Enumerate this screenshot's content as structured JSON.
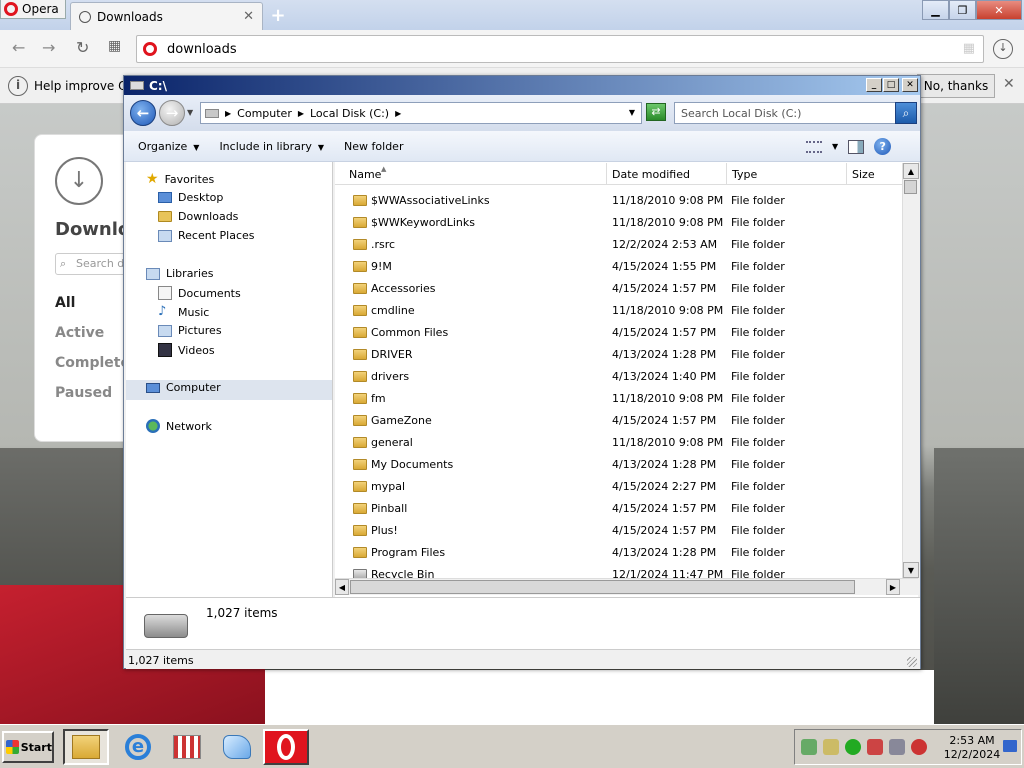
{
  "browser": {
    "menu_label": "Opera",
    "tab_title": "Downloads",
    "address": "downloads",
    "infobar_text": "Help improve Op",
    "no_thanks_label": "No, thanks",
    "downloads_page": {
      "title": "Downlo",
      "search_placeholder": "Search do",
      "filters": [
        "All",
        "Active",
        "Complete",
        "Paused"
      ]
    }
  },
  "explorer": {
    "title": "C:\\",
    "breadcrumb": [
      "Computer",
      "Local Disk (C:)"
    ],
    "search_placeholder": "Search Local Disk (C:)",
    "commands": [
      "Organize",
      "Include in library",
      "New folder"
    ],
    "nav": {
      "favorites": "Favorites",
      "favorites_items": [
        "Desktop",
        "Downloads",
        "Recent Places"
      ],
      "libraries": "Libraries",
      "libraries_items": [
        "Documents",
        "Music",
        "Pictures",
        "Videos"
      ],
      "computer": "Computer",
      "network": "Network"
    },
    "columns": [
      "Name",
      "Date modified",
      "Type",
      "Size"
    ],
    "files": [
      {
        "name": "$WWAssociativeLinks",
        "date": "11/18/2010 9:08 PM",
        "type": "File folder"
      },
      {
        "name": "$WWKeywordLinks",
        "date": "11/18/2010 9:08 PM",
        "type": "File folder"
      },
      {
        "name": ".rsrc",
        "date": "12/2/2024 2:53 AM",
        "type": "File folder"
      },
      {
        "name": "9!M",
        "date": "4/15/2024 1:55 PM",
        "type": "File folder"
      },
      {
        "name": "Accessories",
        "date": "4/15/2024 1:57 PM",
        "type": "File folder"
      },
      {
        "name": "cmdline",
        "date": "11/18/2010 9:08 PM",
        "type": "File folder"
      },
      {
        "name": "Common Files",
        "date": "4/15/2024 1:57 PM",
        "type": "File folder"
      },
      {
        "name": "DRIVER",
        "date": "4/13/2024 1:28 PM",
        "type": "File folder"
      },
      {
        "name": "drivers",
        "date": "4/13/2024 1:40 PM",
        "type": "File folder"
      },
      {
        "name": "fm",
        "date": "11/18/2010 9:08 PM",
        "type": "File folder"
      },
      {
        "name": "GameZone",
        "date": "4/15/2024 1:57 PM",
        "type": "File folder"
      },
      {
        "name": "general",
        "date": "11/18/2010 9:08 PM",
        "type": "File folder"
      },
      {
        "name": "My Documents",
        "date": "4/13/2024 1:28 PM",
        "type": "File folder"
      },
      {
        "name": "mypal",
        "date": "4/15/2024 2:27 PM",
        "type": "File folder"
      },
      {
        "name": "Pinball",
        "date": "4/15/2024 1:57 PM",
        "type": "File folder"
      },
      {
        "name": "Plus!",
        "date": "4/15/2024 1:57 PM",
        "type": "File folder"
      },
      {
        "name": "Program Files",
        "date": "4/13/2024 1:28 PM",
        "type": "File folder"
      },
      {
        "name": "Recycle Bin",
        "date": "12/1/2024 11:47 PM",
        "type": "File folder"
      }
    ],
    "details_count": "1,027 items",
    "status_text": "1,027 items"
  },
  "taskbar": {
    "start_label": "Start",
    "time": "2:53 AM",
    "date": "12/2/2024"
  },
  "colors": {
    "opera_red": "#e0141e",
    "title_gradient_start": "#0a246a",
    "title_gradient_end": "#a6caf0",
    "taskbar": "#d4d0c8"
  }
}
